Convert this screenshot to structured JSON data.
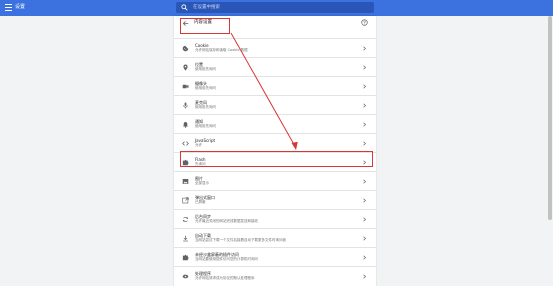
{
  "header": {
    "app_title": "设置",
    "search_placeholder": "在设置中搜索"
  },
  "page": {
    "title": "内容设置"
  },
  "rows": [
    {
      "title": "Cookie",
      "subtitle": "允许网站保存和读取 Cookie 数据",
      "icon": "cookie-icon"
    },
    {
      "title": "位置",
      "subtitle": "使用前先询问",
      "icon": "location-icon"
    },
    {
      "title": "摄像头",
      "subtitle": "使用前先询问",
      "icon": "camera-icon"
    },
    {
      "title": "麦克风",
      "subtitle": "使用前先询问",
      "icon": "microphone-icon"
    },
    {
      "title": "通知",
      "subtitle": "使用前先询问",
      "icon": "bell-icon"
    },
    {
      "title": "JavaScript",
      "subtitle": "允许",
      "icon": "code-icon"
    },
    {
      "title": "Flash",
      "subtitle": "先询问",
      "icon": "puzzle-icon"
    },
    {
      "title": "图片",
      "subtitle": "全部显示",
      "icon": "image-icon"
    },
    {
      "title": "弹出式窗口",
      "subtitle": "已屏蔽",
      "icon": "popup-icon"
    },
    {
      "title": "后台同步",
      "subtitle": "允许最近关闭的网站完成数据发送和接收",
      "icon": "sync-icon"
    },
    {
      "title": "自动下载",
      "subtitle": "当网站尝试下载一个文件后接着自动下载更多文件时询问我",
      "icon": "download-icon"
    },
    {
      "title": "未经沙盒屏蔽的插件访问",
      "subtitle": "当网站要使用插件访问您的计算机时询问",
      "icon": "plugin-icon"
    },
    {
      "title": "处理程序",
      "subtitle": "允许网站请求成为协议的默认处理程序",
      "icon": "handler-icon"
    }
  ],
  "colors": {
    "header_blue": "#3b72e0",
    "search_bg": "#2a56b8",
    "highlight_red": "#d93636",
    "page_bg": "#f1f3f4"
  }
}
